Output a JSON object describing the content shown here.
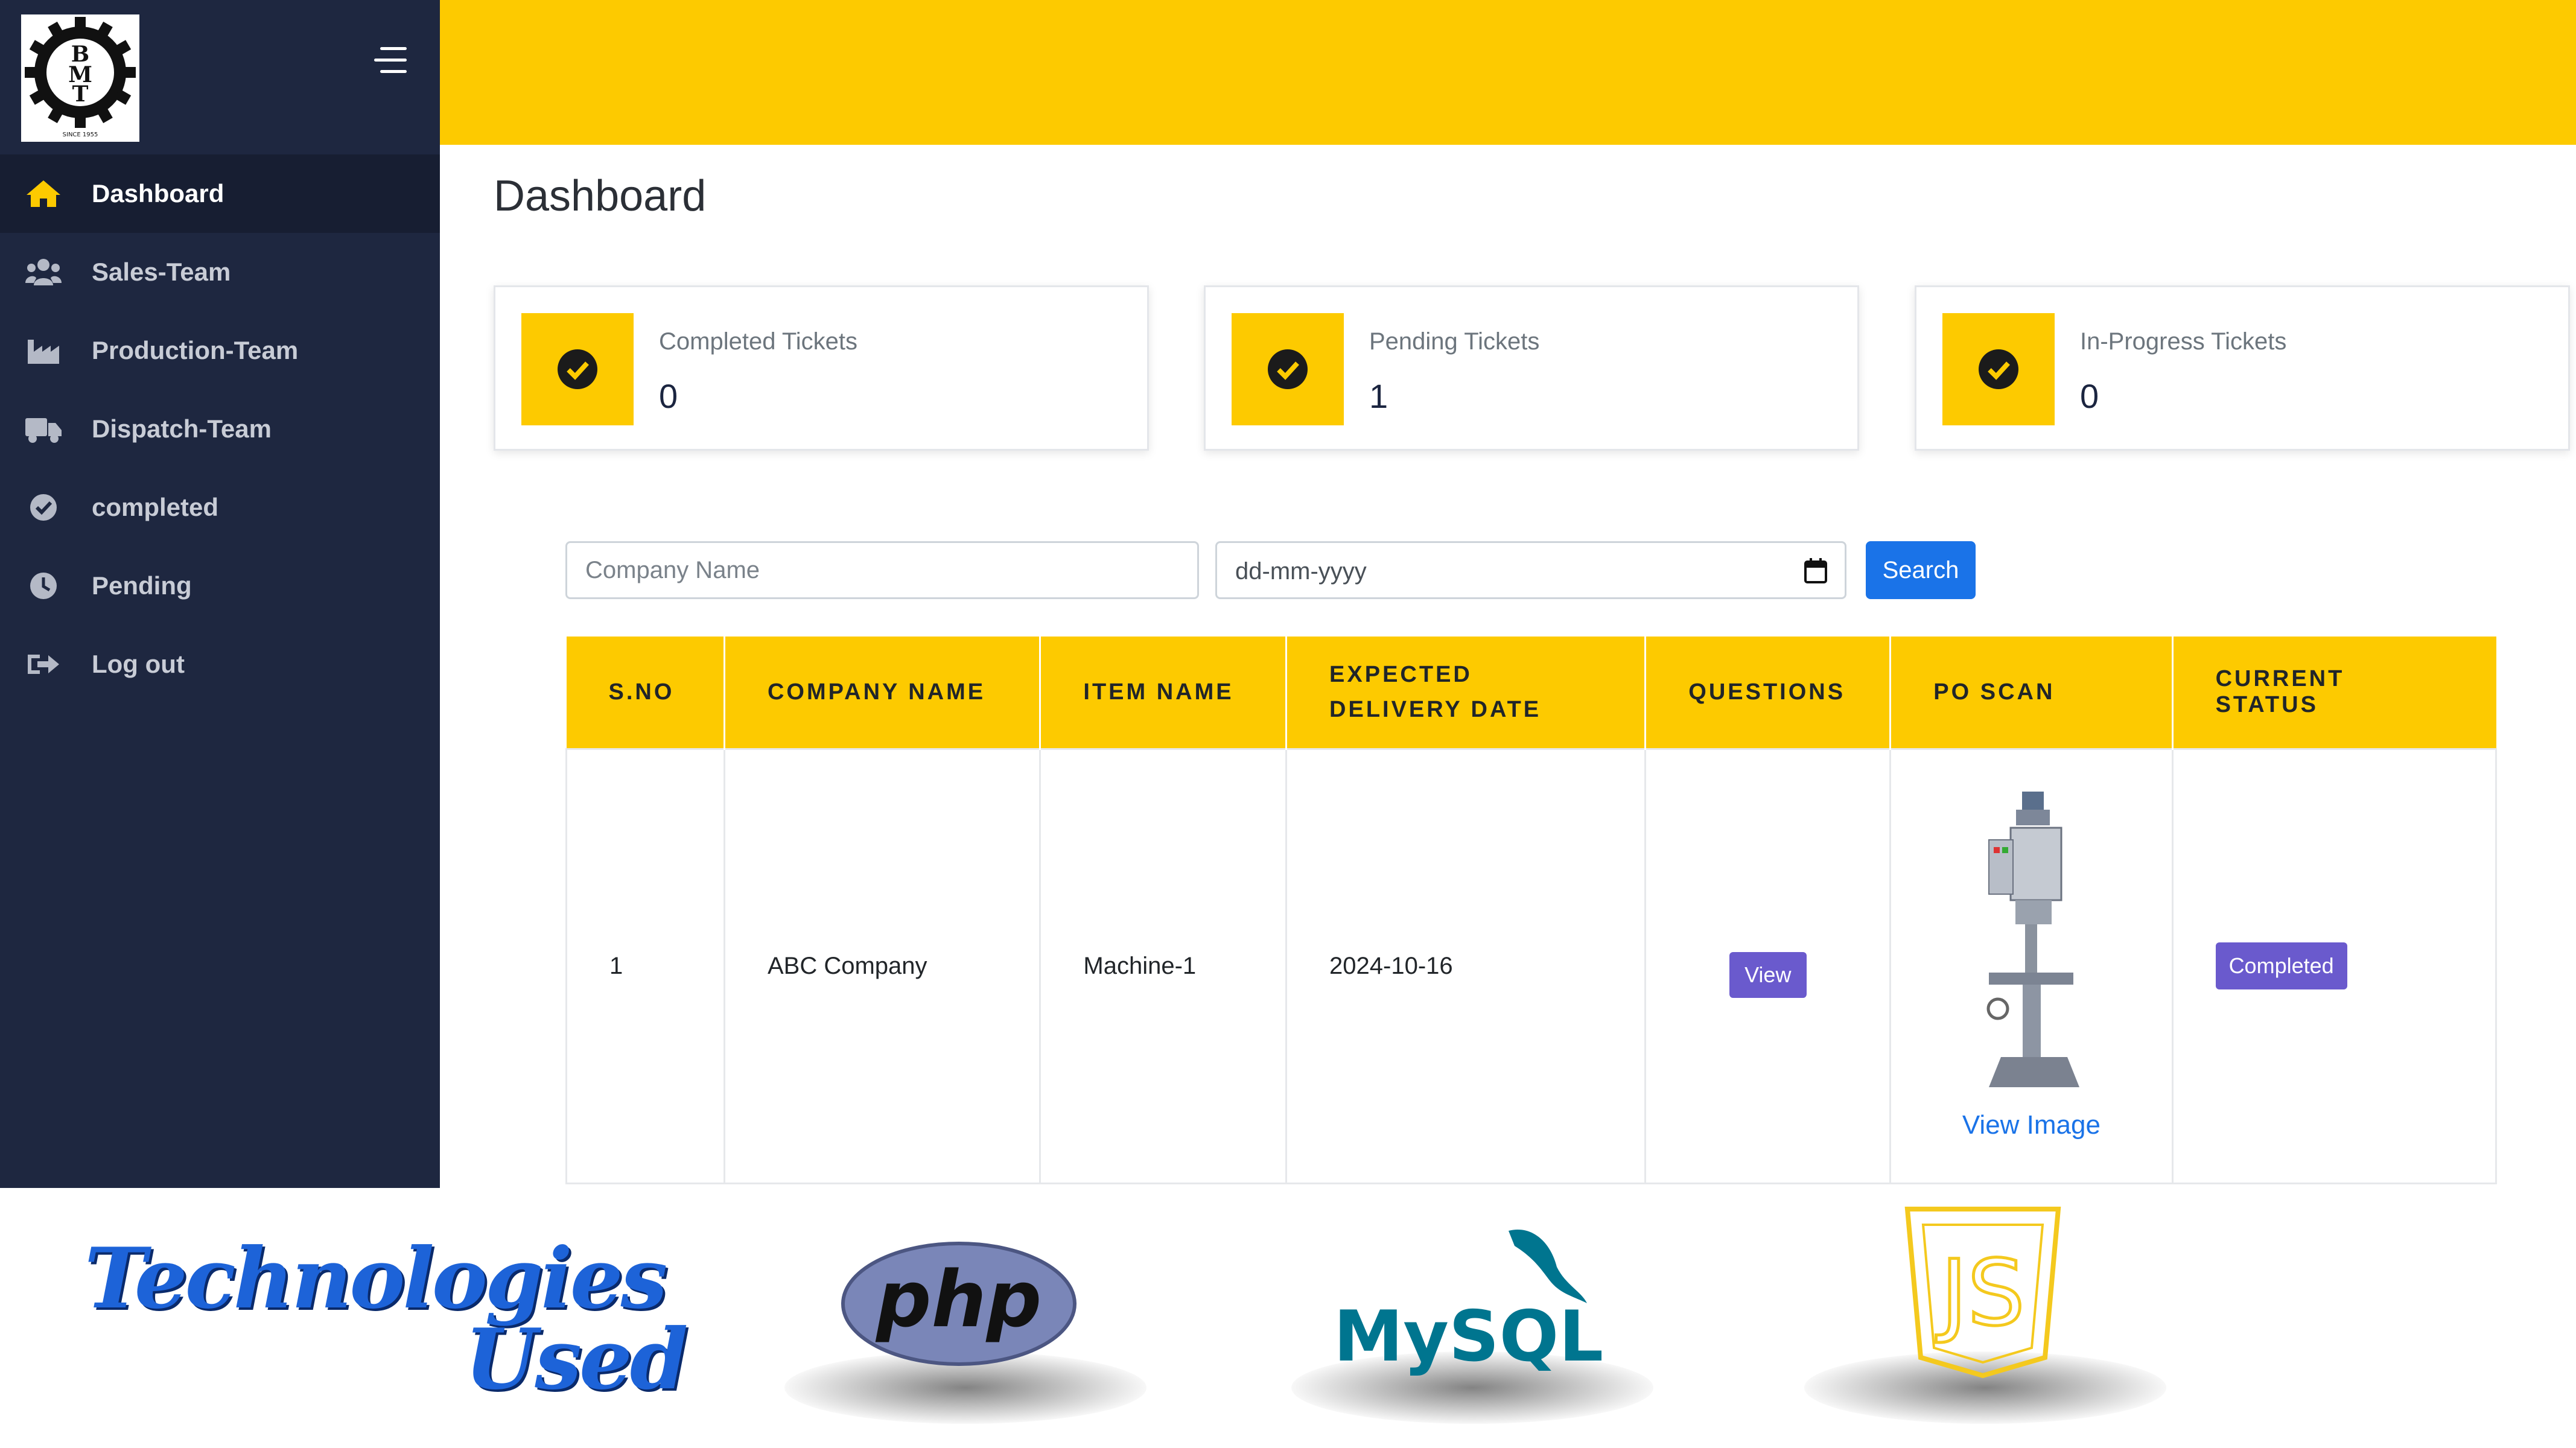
{
  "brand": {
    "logo_letters": "BMT",
    "logo_caption": "SINCE 1955"
  },
  "sidebar": {
    "items": [
      {
        "label": "Dashboard",
        "icon": "home-icon",
        "active": true
      },
      {
        "label": "Sales-Team",
        "icon": "users-icon"
      },
      {
        "label": "Production-Team",
        "icon": "industry-icon"
      },
      {
        "label": "Dispatch-Team",
        "icon": "truck-icon"
      },
      {
        "label": "completed",
        "icon": "check-circle-icon"
      },
      {
        "label": "Pending",
        "icon": "clock-icon"
      },
      {
        "label": "Log out",
        "icon": "logout-icon"
      }
    ]
  },
  "page": {
    "title": "Dashboard"
  },
  "stats": [
    {
      "label": "Completed Tickets",
      "value": "0",
      "icon": "check-circle-icon"
    },
    {
      "label": "Pending Tickets",
      "value": "1",
      "icon": "check-circle-icon"
    },
    {
      "label": "In-Progress Tickets",
      "value": "0",
      "icon": "check-circle-icon"
    }
  ],
  "search": {
    "company_placeholder": "Company Name",
    "date_placeholder": "dd-mm-yyyy",
    "button_label": "Search"
  },
  "table": {
    "headers": [
      "S.NO",
      "COMPANY NAME",
      "ITEM NAME",
      "EXPECTED DELIVERY DATE",
      "QUESTIONS",
      "PO SCAN",
      "CURRENT STATUS"
    ],
    "rows": [
      {
        "sno": "1",
        "company": "ABC Company",
        "item": "Machine-1",
        "delivery_date": "2024-10-16",
        "questions_button": "View",
        "po_link": "View Image",
        "status": "Completed"
      }
    ]
  },
  "tech": {
    "title_line1": "Technologies",
    "title_line2": "Used",
    "logos": [
      {
        "name": "php",
        "text": "php"
      },
      {
        "name": "mysql",
        "text": "MySQL"
      },
      {
        "name": "javascript",
        "text": "JS"
      }
    ]
  },
  "colors": {
    "accent": "#fdca00",
    "sidebar": "#1e2740",
    "primary": "#1a73e8",
    "badge": "#6a5acd"
  }
}
